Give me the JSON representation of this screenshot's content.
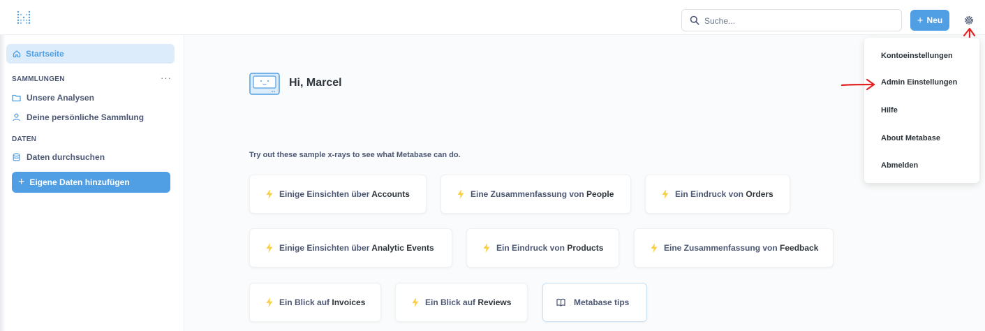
{
  "topbar": {
    "search_placeholder": "Suche...",
    "new_button_label": "Neu",
    "icons": [
      "metabase-logo-icon",
      "search-icon",
      "plus-icon",
      "gear-icon"
    ]
  },
  "sidebar": {
    "home_label": "Startseite",
    "collections_heading": "SAMMLUNGEN",
    "collections_more": "···",
    "collections": [
      {
        "label": "Unsere Analysen",
        "icon": "folder-icon"
      },
      {
        "label": "Deine persönliche Sammlung",
        "icon": "person-icon"
      }
    ],
    "data_heading": "DATEN",
    "browse_data_label": "Daten durchsuchen",
    "add_data_label": "Eigene Daten hinzufügen"
  },
  "main": {
    "greeting": "Hi, Marcel",
    "xray_intro": "Try out these sample x-rays to see what Metabase can do.",
    "xrays": [
      {
        "prefix": "Einige Einsichten über ",
        "keyword": "Accounts"
      },
      {
        "prefix": "Eine Zusammenfassung von ",
        "keyword": "People"
      },
      {
        "prefix": "Ein Eindruck von ",
        "keyword": "Orders"
      },
      {
        "prefix": "Einige Einsichten über ",
        "keyword": "Analytic Events"
      },
      {
        "prefix": "Ein Eindruck von ",
        "keyword": "Products"
      },
      {
        "prefix": "Eine Zusammenfassung von ",
        "keyword": "Feedback"
      },
      {
        "prefix": "Ein Blick auf ",
        "keyword": "Invoices"
      },
      {
        "prefix": "Ein Blick auf ",
        "keyword": "Reviews"
      }
    ],
    "tips_label": "Metabase tips"
  },
  "settings_menu": {
    "items": [
      "Kontoeinstellungen",
      "Admin Einstellungen",
      "Hilfe",
      "About Metabase",
      "Abmelden"
    ]
  },
  "colors": {
    "brand": "#509ee3",
    "bolt": "#f9cf48",
    "annotation_arrow": "#e32222"
  }
}
